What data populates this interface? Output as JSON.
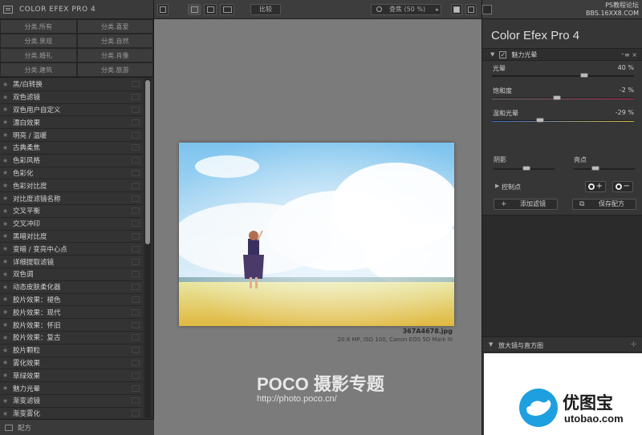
{
  "left_panel": {
    "title": "COLOR EFEX PRO 4",
    "categories": [
      "分类.所有",
      "分类.喜爱",
      "分类.景观",
      "分类.自然",
      "分类.婚礼",
      "分类.肖像",
      "分类.建筑",
      "分类.旅游"
    ],
    "filters": [
      "黑/白转换",
      "双色滤镜",
      "双色用户自定义",
      "漂白效果",
      "明亮 / 温暖",
      "古典柔焦",
      "色彩风格",
      "色彩化",
      "色彩对比度",
      "对比度滤镜名称",
      "交叉平衡",
      "交叉冲印",
      "黑暗对比度",
      "变暗 / 变亮中心点",
      "详细提取滤镜",
      "双色调",
      "动态皮肤柔化器",
      "胶片效果：褪色",
      "胶片效果：现代",
      "胶片效果：怀旧",
      "胶片效果：复古",
      "胶片颗粒",
      "雾化效果",
      "草绿效果",
      "魅力光晕",
      "渐变滤镜",
      "渐变雾化"
    ],
    "footer": "配方",
    "star_icon": "★"
  },
  "toolbar": {
    "compare_label": "比较",
    "zoom_label": "查焦 (50 %)",
    "zoom_arrow": "▸"
  },
  "preview": {
    "file_name": "367A4678.jpg",
    "file_info": "20.8 MP, ISO 100, Canon EOS 5D Mark III",
    "watermark_title": "POCO 摄影专题",
    "watermark_url": "http://photo.poco.cn/"
  },
  "right_panel": {
    "corner_line1": "PS教程论坛",
    "corner_line2": "BBS.16XX8.COM",
    "app_title": "Color Efex Pro 4",
    "filter_name": "魅力光晕",
    "filter_tools": "⁺≡ ×",
    "sliders": [
      {
        "name": "光晕",
        "value": "40 %",
        "level": 40
      },
      {
        "name": "饱和度",
        "value": "-2 %",
        "level": -2
      },
      {
        "name": "温和光晕",
        "value": "-29 %",
        "level": -29
      }
    ],
    "shadows_label": "阴影",
    "highlights_label": "亮点",
    "control_points_label": "控制点",
    "add_filter_label": "添加滤镜",
    "save_recipe_label": "保存配方",
    "loupe_label": "放大镜与直方图",
    "logo_cn": "优图宝",
    "logo_en": "utobao.com"
  },
  "colors": {
    "preview_bg": "#7b7b7b",
    "panel_bg": "#363636",
    "logo_blue": "#1d9fe0"
  }
}
